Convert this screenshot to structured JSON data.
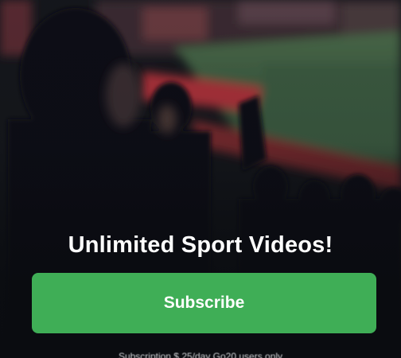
{
  "headline": "Unlimited Sport Videos!",
  "subscribe_button": {
    "label": "Subscribe"
  },
  "terms_text": "Subscription $ 25/day Go20 users only",
  "colors": {
    "button_bg": "#3fae56",
    "overlay": "#0d0f14",
    "text": "#ffffff"
  }
}
